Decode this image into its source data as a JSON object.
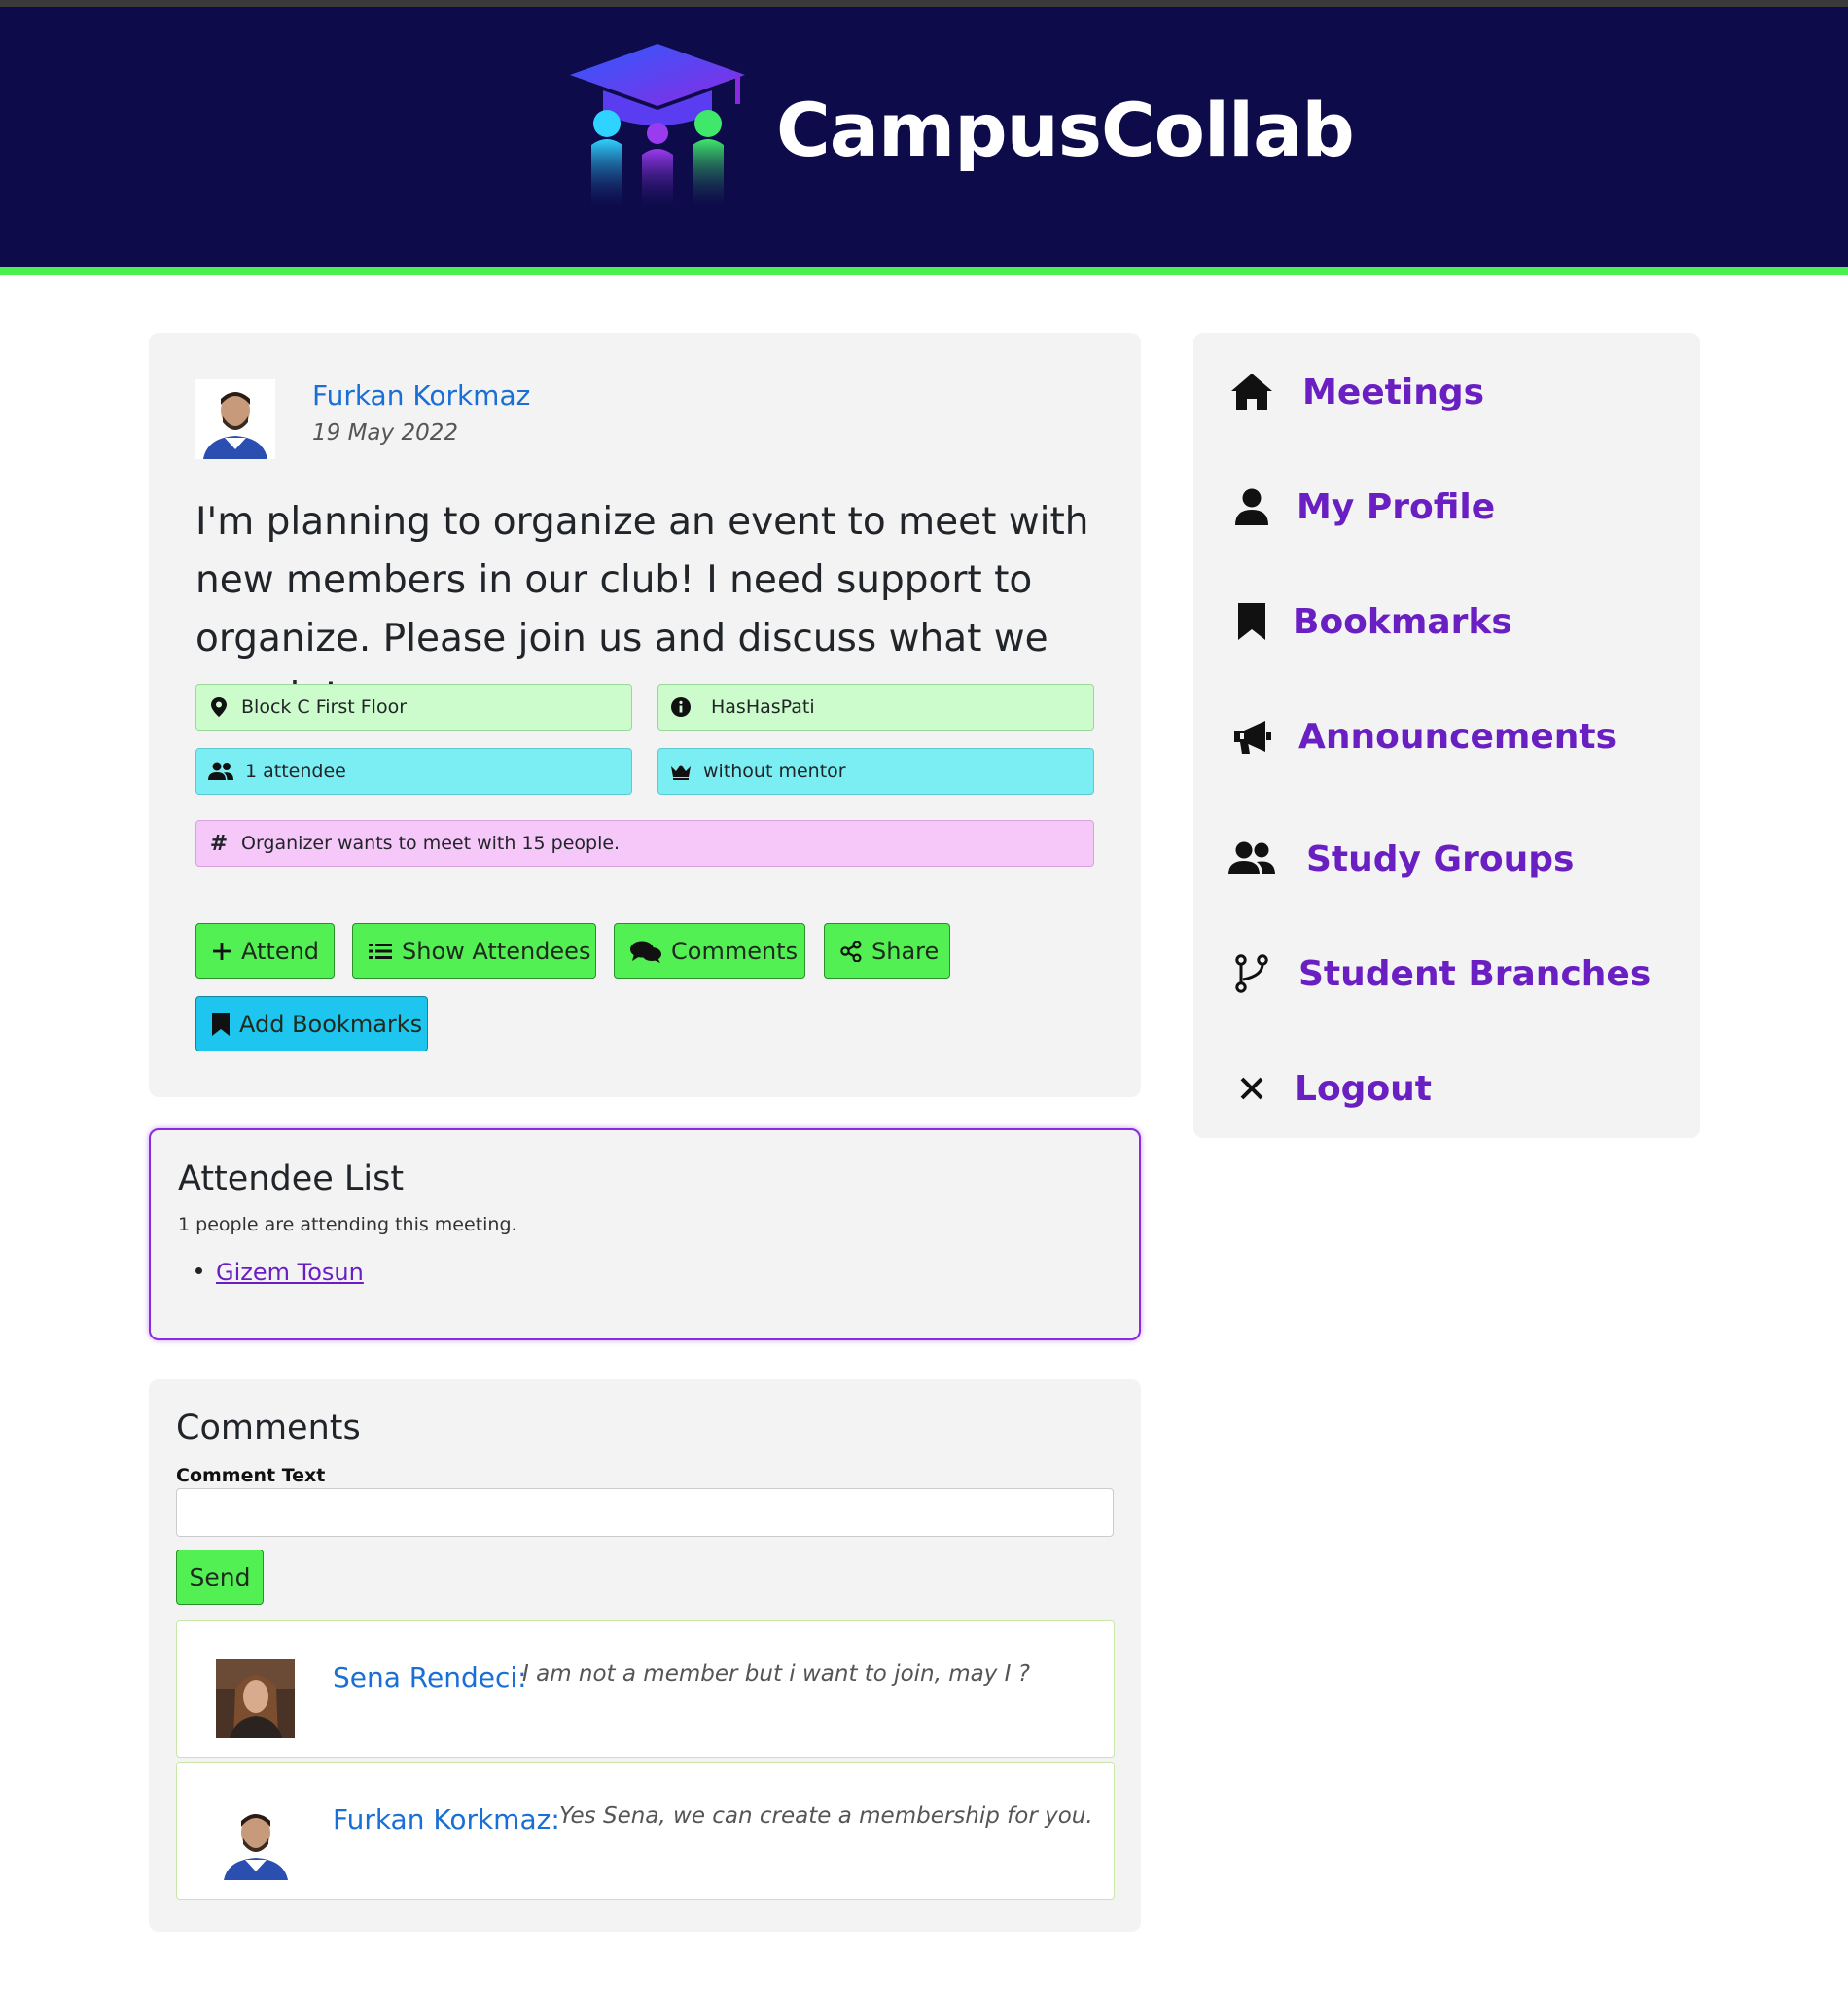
{
  "header": {
    "brand": "CampusCollab"
  },
  "post": {
    "author": "Furkan Korkmaz",
    "date": "19 May 2022",
    "text": "I'm planning to organize an event to meet with new members in our club! I need support to organize. Please join us and discuss what we can do!",
    "tags": {
      "location": "Block C First Floor",
      "club": "HasHasPati",
      "attendees": "1 attendee",
      "mentor": "without mentor",
      "capacity": "Organizer wants to meet with 15 people."
    },
    "buttons": {
      "attend": "Attend",
      "show_attendees": "Show Attendees",
      "comments": "Comments",
      "share": "Share",
      "add_bookmarks": "Add Bookmarks"
    }
  },
  "attendees": {
    "title": "Attendee List",
    "subtitle": "1 people are attending this meeting.",
    "items": [
      "Gizem Tosun"
    ]
  },
  "comments": {
    "title": "Comments",
    "field_label": "Comment Text",
    "input_value": "",
    "send_label": "Send",
    "items": [
      {
        "author": "Sena Rendeci:",
        "text": "I am not a member but i want to join, may I ?"
      },
      {
        "author": "Furkan Korkmaz:",
        "text": "Yes Sena, we can create a membership for you."
      }
    ]
  },
  "sidebar": {
    "items": [
      {
        "label": "Meetings",
        "icon": "home-icon"
      },
      {
        "label": "My Profile",
        "icon": "user-icon"
      },
      {
        "label": "Bookmarks",
        "icon": "bookmark-icon"
      },
      {
        "label": "Announcements",
        "icon": "megaphone-icon"
      },
      {
        "label": "Study Groups",
        "icon": "users-icon"
      },
      {
        "label": "Student Branches",
        "icon": "branch-icon"
      },
      {
        "label": "Logout",
        "icon": "close-icon"
      }
    ]
  },
  "colors": {
    "header_bg": "#0e0b4b",
    "accent_green": "#4cf04c",
    "link_blue": "#1a6fd6",
    "nav_purple": "#6a1fc2",
    "button_green": "#52f052",
    "button_blue": "#1ec6ef"
  }
}
